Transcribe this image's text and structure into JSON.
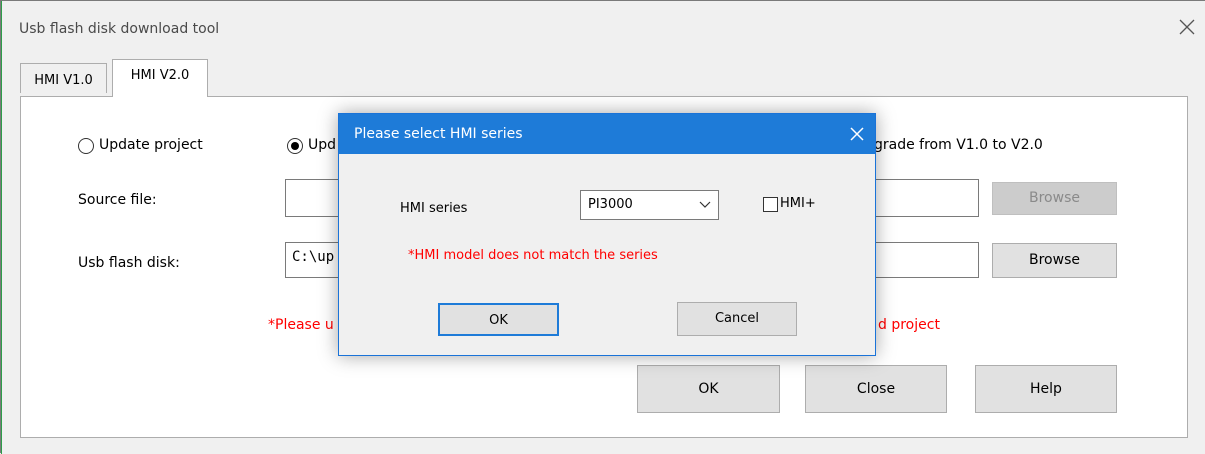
{
  "window": {
    "title": "Usb flash disk download tool"
  },
  "tabs": [
    {
      "label": "HMI V1.0",
      "active": false
    },
    {
      "label": "HMI V2.0",
      "active": true
    }
  ],
  "panel": {
    "radio_update_project": "Update project",
    "radio_update_partial": "Upd",
    "radio_upgrade_partial": "grade from V1.0 to V2.0",
    "source_file_label": "Source file:",
    "source_file_value": "",
    "usb_disk_label": "Usb flash disk:",
    "usb_disk_value_partial": "C:\\up",
    "browse_label": "Browse",
    "warning_left": "*Please u",
    "warning_right": "d project",
    "ok_label": "OK",
    "close_label": "Close",
    "help_label": "Help"
  },
  "dialog": {
    "title": "Please select HMI series",
    "series_label": "HMI series",
    "series_value": "PI3000",
    "hmi_plus_label": "HMI+",
    "hmi_plus_checked": false,
    "error_message": "*HMI model does not match the series",
    "ok_label": "OK",
    "cancel_label": "Cancel"
  },
  "colors": {
    "title_bar": "#1e7bd8",
    "error_red": "#ff0000"
  },
  "icons": [
    "close-icon",
    "chevron-down-icon"
  ]
}
